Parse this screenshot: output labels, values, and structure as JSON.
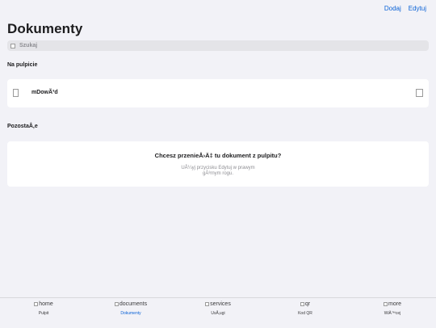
{
  "header": {
    "add_label": "Dodaj",
    "edit_label": "Edytuj",
    "title": "Dokumenty"
  },
  "search": {
    "placeholder": "Szukaj"
  },
  "sections": {
    "desktop_label": "Na pulpicie",
    "others_label": "PozostaÅ‚e"
  },
  "desktop_documents": [
    {
      "name": "mDowÃ³d",
      "icon": "document-icon",
      "arrow_icon": "chevron-right-icon"
    }
  ],
  "info_card": {
    "heading": "Chcesz przenieÅ›Ä‡ tu dokument z pulpitu?",
    "body_line1": "UÅ¼yj przycisku Edytuj w prawym",
    "body_line2": "gÃ³rnym rogu."
  },
  "tabbar": {
    "tabs": [
      {
        "icon_alt": "home",
        "label": "Pulpit",
        "active": false
      },
      {
        "icon_alt": "documents",
        "label": "Dokumenty",
        "active": true
      },
      {
        "icon_alt": "services",
        "label": "UsÅ‚ugi",
        "active": false
      },
      {
        "icon_alt": "qr",
        "label": "Kod QR",
        "active": false
      },
      {
        "icon_alt": "more",
        "label": "WiÄ™cej",
        "active": false
      }
    ]
  },
  "colors": {
    "accent": "#0a62d6",
    "background": "#f2f2f7",
    "card": "#ffffff"
  }
}
